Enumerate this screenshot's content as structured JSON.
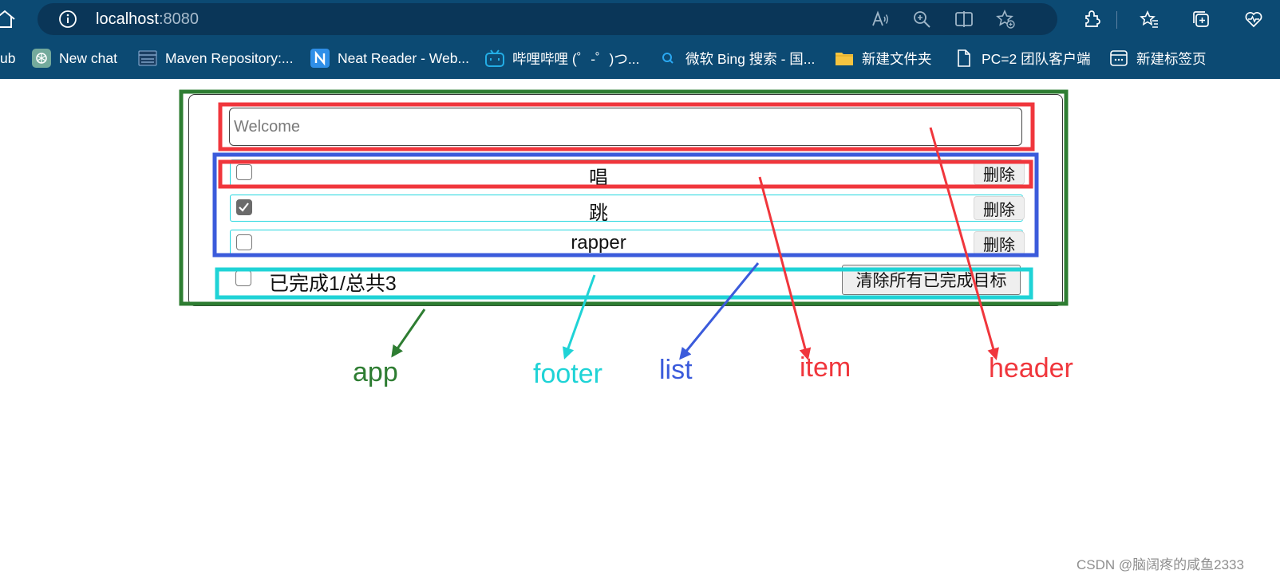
{
  "browser": {
    "url_host": "localhost",
    "url_port": ":8080",
    "icons": [
      "home-icon",
      "info-icon",
      "read-aloud-icon",
      "zoom-in-icon",
      "split-screen-icon",
      "favorite-add-icon",
      "extensions-icon",
      "favorites-icon",
      "collections-icon",
      "browser-essentials-icon"
    ],
    "bookmarks": [
      {
        "label": "ub",
        "icon": ""
      },
      {
        "label": "New chat",
        "icon": "chatgpt-icon"
      },
      {
        "label": "Maven Repository:...",
        "icon": "maven-icon"
      },
      {
        "label": "Neat Reader - Web...",
        "icon": "neat-reader-icon"
      },
      {
        "label": "哔哩哔哩 (゜-゜)つ...",
        "icon": "bilibili-icon"
      },
      {
        "label": "微软 Bing 搜索 - 国...",
        "icon": "search-icon"
      },
      {
        "label": "新建文件夹",
        "icon": "folder-icon"
      },
      {
        "label": "PC=2 团队客户端",
        "icon": "file-icon"
      },
      {
        "label": "新建标签页",
        "icon": "new-tab-icon"
      }
    ]
  },
  "todo": {
    "header": {
      "placeholder": "Welcome"
    },
    "items": [
      {
        "title": "唱",
        "done": false,
        "delete_label": "删除"
      },
      {
        "title": "跳",
        "done": true,
        "delete_label": "删除"
      },
      {
        "title": "rapper",
        "done": false,
        "delete_label": "删除"
      }
    ],
    "footer": {
      "status": "已完成1/总共3",
      "all_checked": false,
      "clear_label": "清除所有已完成目标"
    }
  },
  "annotations": {
    "labels": [
      {
        "text": "app",
        "color": "#2e7d32"
      },
      {
        "text": "footer",
        "color": "#1fd3d6"
      },
      {
        "text": "list",
        "color": "#3b5bdb"
      },
      {
        "text": "item",
        "color": "#f0363c"
      },
      {
        "text": "header",
        "color": "#f0363c"
      }
    ],
    "box_colors": {
      "app": "#2e7d32",
      "header": "#f0363c",
      "item": "#f0363c",
      "list": "#3b5bdb",
      "footer": "#1fd3d6"
    }
  },
  "watermark": "CSDN @脑阔疼的咸鱼2333"
}
